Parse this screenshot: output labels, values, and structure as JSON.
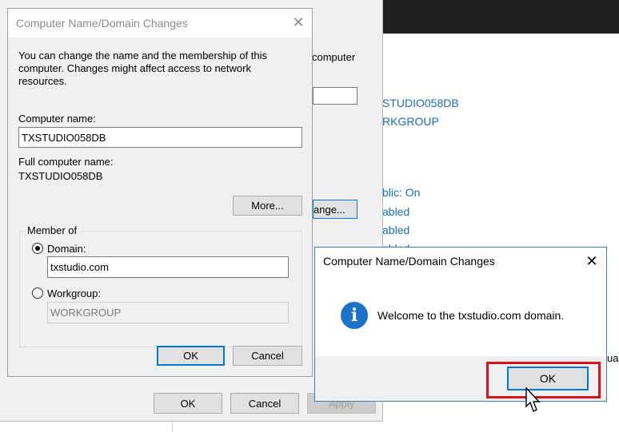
{
  "background": {
    "partial_text": [
      "computer",
      "STUDIO058DB",
      "RKGROUP",
      "blic: On",
      "abled",
      "abled",
      "abled",
      "ua"
    ],
    "change_button_partial": "ange..."
  },
  "sysprops": {
    "ok_label": "OK",
    "cancel_label": "Cancel",
    "apply_label": "Apply"
  },
  "domain_dialog": {
    "title": "Computer Name/Domain Changes",
    "description": "You can change the name and the membership of this computer. Changes might affect access to network resources.",
    "computer_name_label": "Computer name:",
    "computer_name_value": "TXSTUDIO058DB",
    "full_name_label": "Full computer name:",
    "full_name_value": "TXSTUDIO058DB",
    "more_label": "More...",
    "member_of_label": "Member of",
    "domain_label": "Domain:",
    "domain_value": "txstudio.com",
    "workgroup_label": "Workgroup:",
    "workgroup_value": "WORKGROUP",
    "ok_label": "OK",
    "cancel_label": "Cancel"
  },
  "welcome_dialog": {
    "title": "Computer Name/Domain Changes",
    "message": "Welcome to the txstudio.com domain.",
    "ok_label": "OK",
    "icon": "info-icon"
  },
  "colors": {
    "accent": "#0078d7",
    "highlight": "#d6141f",
    "link": "#1a6fb8"
  }
}
